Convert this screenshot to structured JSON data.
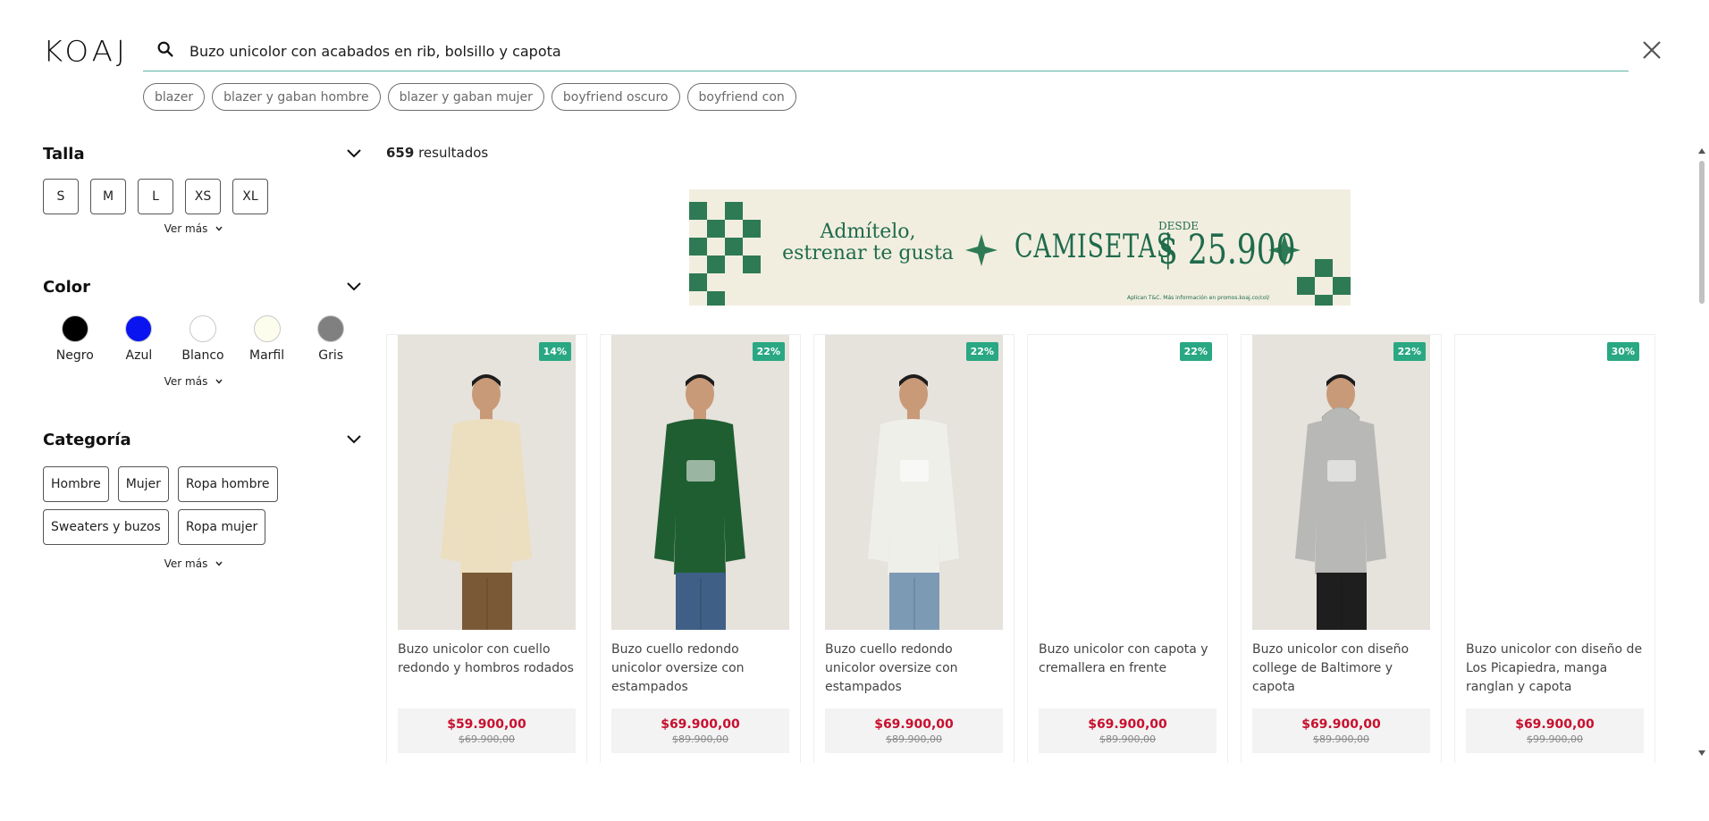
{
  "brand": {
    "logo": "KOAJ"
  },
  "search": {
    "value": "Buzo unicolor con acabados en rib, bolsillo y capota"
  },
  "suggestions": [
    "blazer",
    "blazer y gaban hombre",
    "blazer y gaban mujer",
    "boyfriend oscuro",
    "boyfriend con"
  ],
  "filters": {
    "talla": {
      "title": "Talla",
      "options": [
        "S",
        "M",
        "L",
        "XS",
        "XL"
      ],
      "more": "Ver más"
    },
    "color": {
      "title": "Color",
      "options": [
        {
          "label": "Negro",
          "hex": "#000000"
        },
        {
          "label": "Azul",
          "hex": "#0a14f0"
        },
        {
          "label": "Blanco",
          "hex": "#ffffff"
        },
        {
          "label": "Marfil",
          "hex": "#fdfdee"
        },
        {
          "label": "Gris",
          "hex": "#808080"
        }
      ],
      "more": "Ver más"
    },
    "categoria": {
      "title": "Categoría",
      "row1": [
        "Hombre",
        "Mujer",
        "Ropa hombre"
      ],
      "row2": [
        "Sweaters y buzos",
        "Ropa mujer"
      ],
      "more": "Ver más"
    }
  },
  "results": {
    "count": "659",
    "label": "resultados"
  },
  "banner": {
    "line1": "Admítelo,",
    "line2": "estrenar te gusta",
    "product": "CAMISETAS",
    "desde": "DESDE",
    "price": "$ 25.900",
    "note": "Aplican T&C. Más información en promos.koaj.co/col/"
  },
  "products": [
    {
      "name": "Buzo unicolor con cuello redondo y hombros rodados",
      "price": "$59.900,00",
      "old": "$69.900,00",
      "discount": "14%",
      "garment": "#ecdfc0",
      "pants": "#7a5a36",
      "hood": false,
      "print": false
    },
    {
      "name": "Buzo cuello redondo unicolor oversize con estampados",
      "price": "$69.900,00",
      "old": "$89.900,00",
      "discount": "22%",
      "garment": "#1f5e31",
      "pants": "#3f5f86",
      "hood": false,
      "print": true
    },
    {
      "name": "Buzo cuello redondo unicolor oversize con estampados",
      "price": "$69.900,00",
      "old": "$89.900,00",
      "discount": "22%",
      "garment": "#efefea",
      "pants": "#7d9ab5",
      "hood": false,
      "print": true
    },
    {
      "name": "Buzo unicolor con capota y cremallera en frente",
      "price": "$69.900,00",
      "old": "$89.900,00",
      "discount": "22%",
      "garment": "",
      "pants": "",
      "hood": false,
      "print": false
    },
    {
      "name": "Buzo unicolor con diseño college de Baltimore y capota",
      "price": "$69.900,00",
      "old": "$89.900,00",
      "discount": "22%",
      "garment": "#b8b8b6",
      "pants": "#1e1e1e",
      "hood": true,
      "print": true
    },
    {
      "name": "Buzo unicolor con diseño de Los Picapiedra, manga ranglan y capota",
      "price": "$69.900,00",
      "old": "$99.900,00",
      "discount": "30%",
      "garment": "",
      "pants": "",
      "hood": false,
      "print": false
    }
  ]
}
